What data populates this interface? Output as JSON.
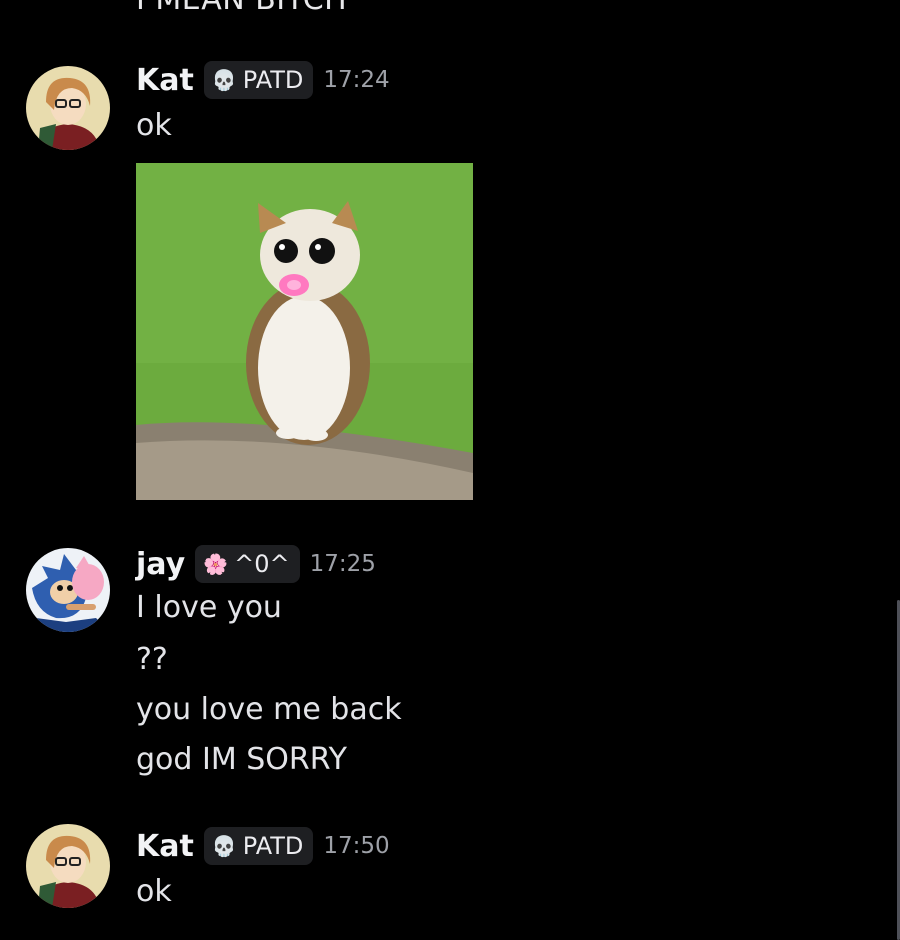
{
  "top_partial_text": "I MEAN BITCH",
  "messages": [
    {
      "username": "Kat",
      "tag": "PATD",
      "tag_icon": "skull-icon",
      "time": "17:24",
      "lines": [
        "ok"
      ],
      "has_image": true,
      "image_desc_icon": "cat-with-pacifier-image"
    },
    {
      "username": "jay",
      "tag": "^0^",
      "tag_icon": "flower-icon",
      "time": "17:25",
      "lines": [
        "I love you",
        "??",
        "you love me back",
        "god IM SORRY"
      ]
    },
    {
      "username": "Kat",
      "tag": "PATD",
      "tag_icon": "skull-icon",
      "time": "17:50",
      "lines": [
        "ok"
      ]
    }
  ],
  "colors": {
    "background": "#000000",
    "tag_background": "#1e1f22",
    "timestamp": "#9ea1a8",
    "text": "#e3e4e8"
  }
}
